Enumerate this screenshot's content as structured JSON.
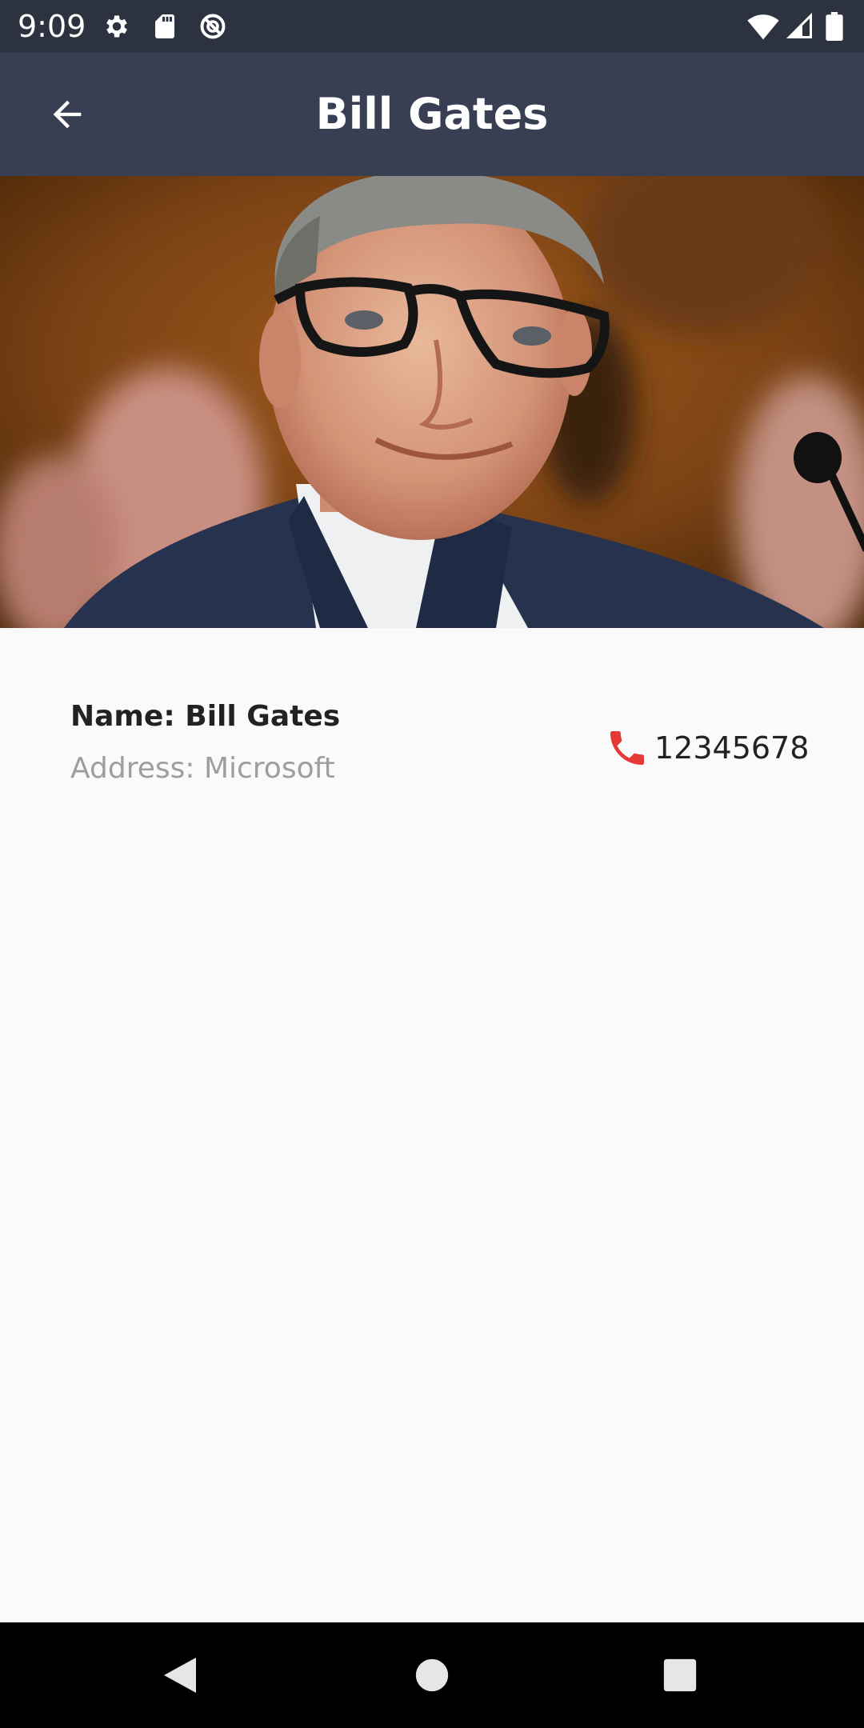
{
  "status_bar": {
    "time": "9:09",
    "left_icons": [
      "gear-icon",
      "sd-card-icon",
      "no-disturb-icon"
    ],
    "right_icons": [
      "wifi-icon",
      "signal-icon",
      "battery-icon"
    ]
  },
  "app_bar": {
    "title": "Bill Gates",
    "back_icon": "arrow-back-icon"
  },
  "profile": {
    "name": "Name: Bill Gates",
    "address": "Address: Microsoft",
    "phone": "12345678",
    "phone_icon": "phone-icon"
  },
  "colors": {
    "status_bar": "#2d3241",
    "app_bar": "#393f53",
    "background": "#fafafa",
    "phone_icon": "#e53935",
    "address_text": "#9e9e9e"
  },
  "nav_bar": {
    "buttons": [
      "back-triangle-icon",
      "home-circle-icon",
      "recents-square-icon"
    ]
  }
}
